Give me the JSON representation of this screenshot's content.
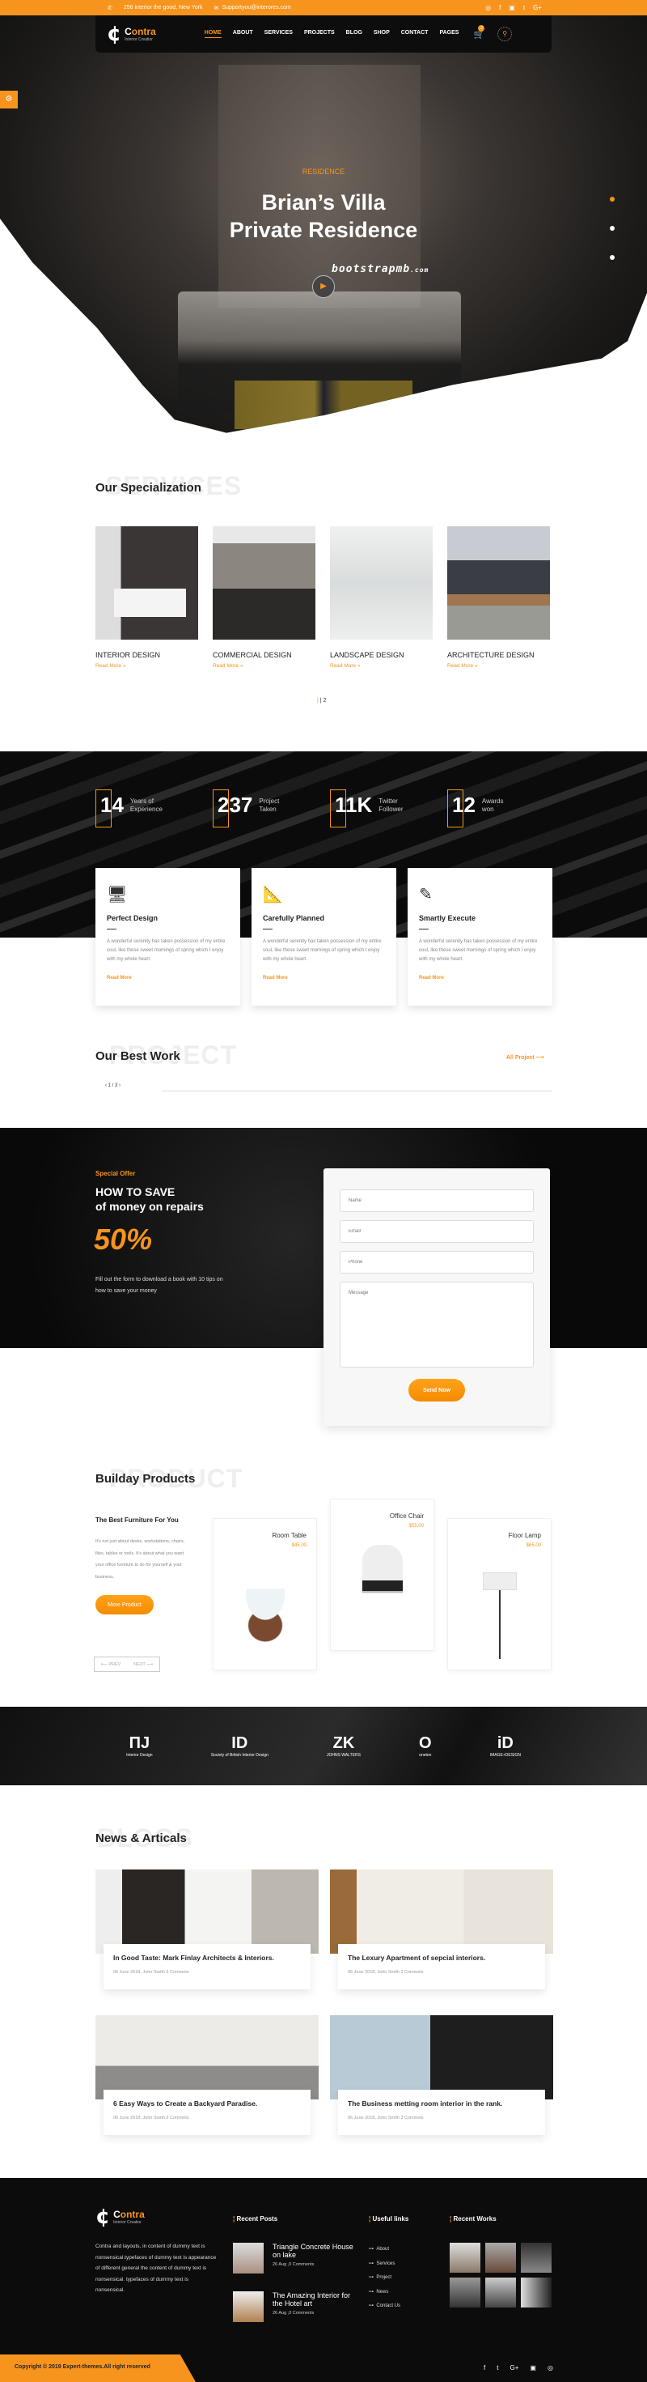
{
  "topbar": {
    "address": "256 interior the good, New York",
    "email": "Supportyou@interores.com",
    "social": [
      "whatsapp-icon",
      "facebook-icon",
      "instagram-icon",
      "twitter-icon",
      "google-plus-icon"
    ]
  },
  "brand": {
    "name_a": "C",
    "name_b": "ontra",
    "tagline": "Interior Creatior",
    "accent": "#f7941d"
  },
  "nav": {
    "items": [
      "HOME",
      "ABOUT",
      "SERVICES",
      "PROJECTS",
      "BLOG",
      "SHOP",
      "CONTACT",
      "PAGES"
    ],
    "active": "HOME",
    "cart_count": "2"
  },
  "hero": {
    "tag": "RESIDENCE",
    "title1": "Brian’s Villa",
    "title2": "Private Residence",
    "watermark": "bootstrapmb",
    "watermark_tld": ".com"
  },
  "specialization": {
    "ghost": "SERVICES",
    "title": "Our Specialization",
    "items": [
      {
        "title": "INTERIOR DESIGN",
        "link": "Read More »"
      },
      {
        "title": "COMMERCIAL DESIGN",
        "link": "Read More »"
      },
      {
        "title": "LANDSCAPE DESIGN",
        "link": "Read More »"
      },
      {
        "title": "ARCHITECTURE DESIGN",
        "link": "Read More »"
      }
    ],
    "pager": "| 2"
  },
  "stats": [
    {
      "n": "14",
      "l1": "Years of",
      "l2": "Experience"
    },
    {
      "n": "237",
      "l1": "Project",
      "l2": "Taken"
    },
    {
      "n": "11K",
      "l1": "Twitter",
      "l2": "Follower"
    },
    {
      "n": "12",
      "l1": "Awards",
      "l2": "won"
    }
  ],
  "features": [
    {
      "title": "Perfect Design",
      "text": "A wonderful serenity has taken possession of my entire soul, like these sweet mornings of spring which I enjoy with my whole heart.",
      "link": "Read More"
    },
    {
      "title": "Carefully Planned",
      "text": "A wonderful serenity has taken possession of my entire soul, like these sweet mornings of spring which I enjoy with my whole heart.",
      "link": "Read More"
    },
    {
      "title": "Smartly Execute",
      "text": "A wonderful serenity has taken possession of my entire soul, like these sweet mornings of spring which I enjoy with my whole heart.",
      "link": "Read More"
    }
  ],
  "work": {
    "ghost": "PROJECT",
    "title": "Our Best Work",
    "all": "All Project ⟶",
    "pager": "‹ 1 / 3 ›"
  },
  "offer": {
    "tag": "Special Offer",
    "h1": "HOW TO SAVE",
    "h2": "of money on repairs",
    "pct": "50%",
    "text": "Fill out the form to download a book with 10 tips on how to save your money",
    "name_ph": "Name",
    "email_ph": "Email",
    "phone_ph": "Phone",
    "msg_ph": "Message",
    "send": "Send Now"
  },
  "products": {
    "ghost": "PRODUCT",
    "title": "Builday Products",
    "sub": "The Best Furniture For You",
    "text": "It's not just about desks, workstations, chairs, files, tables or tools. It's about what you want your office furniture to do for yourself & your business.",
    "more": "More Product",
    "prev": "⟵ PREV",
    "next": "NEXT ⟶",
    "items": [
      {
        "name": "Room Table",
        "price": "$45.00"
      },
      {
        "name": "Office Chair",
        "price": "$55.00"
      },
      {
        "name": "Floor Lamp",
        "price": "$65.00"
      }
    ]
  },
  "partners": [
    {
      "mark": "ПJ",
      "label": "Interior Design"
    },
    {
      "mark": "ID",
      "label": "Society of British Interior Design"
    },
    {
      "mark": "ZK",
      "label": "JOHNS WALTERS"
    },
    {
      "mark": "O",
      "label": "oneten"
    },
    {
      "mark": "iD",
      "label": "IMAGE+DESIGN"
    }
  ],
  "news": {
    "ghost": "BLOGS",
    "title": "News & Articals",
    "items": [
      {
        "title": "In Good Taste: Mark Finlay Architects & Interiors.",
        "meta": "06 June 2018,   John Smith   3 Commets"
      },
      {
        "title": "The Lexury Apartment of sepcial interiors.",
        "meta": "06 June 2018,   John Smith   3 Commets"
      },
      {
        "title": "6 Easy Ways to Create a Backyard Paradise.",
        "meta": "06 June 2018,   John Smith   3 Commets"
      },
      {
        "title": "The Business metting room interior in the rank.",
        "meta": "06 June 2018,   John Smith   3 Commets"
      }
    ]
  },
  "footer": {
    "about": "Contra and layouts, in content of dummy text is nonsensical.typefaces of dummy text is appearance of different general the content of dummy text is nonsensical. typefaces of dummy text is nonsensical.",
    "recent_posts_h": "Recent Posts",
    "posts": [
      {
        "title": "Triangle Concrete House on lake",
        "meta": "26 Aug ,0 Comments"
      },
      {
        "title": "The Amazing Interior for the Hotel art",
        "meta": "26 Aug ,0 Comments"
      }
    ],
    "links_h": "Useful links",
    "links": [
      "About",
      "Services",
      "Project",
      "News",
      "Contact Us"
    ],
    "works_h": "Recent Works",
    "copyright": "Copyright © 2019 Expert-themes.All right reserved",
    "social": [
      "facebook-icon",
      "twitter-icon",
      "google-plus-icon",
      "instagram-icon",
      "whatsapp-icon"
    ]
  }
}
